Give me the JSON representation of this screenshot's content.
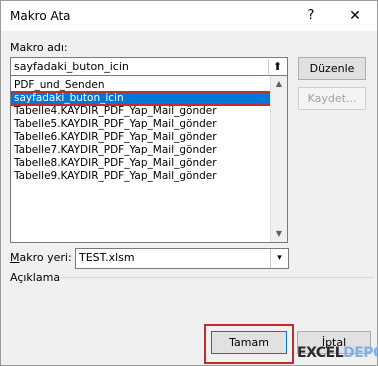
{
  "window": {
    "title": "Makro Ata",
    "help": "?",
    "close": "✕"
  },
  "macro_name": {
    "label": "Makro adı:",
    "value": "sayfadaki_buton_icin",
    "ref_icon": "⬆"
  },
  "macro_list": {
    "items": [
      "PDF_und_Senden",
      "sayfadaki_buton_icin",
      "Tabelle4.KAYDIR_PDF_Yap_Mail_gönder",
      "Tabelle5.KAYDIR_PDF_Yap_Mail_gönder",
      "Tabelle6.KAYDIR_PDF_Yap_Mail_gönder",
      "Tabelle7.KAYDIR_PDF_Yap_Mail_gönder",
      "Tabelle8.KAYDIR_PDF_Yap_Mail_gönder",
      "Tabelle9.KAYDIR_PDF_Yap_Mail_gönder"
    ],
    "selected_index": 1,
    "scroll_up": "▲",
    "scroll_down": "▼"
  },
  "buttons": {
    "edit": "Düzenle",
    "record": "Kaydet...",
    "ok": "Tamam",
    "cancel": "İptal"
  },
  "macros_in": {
    "label": "Makro yeri:",
    "value": "TEST.xlsm",
    "arrow": "▾"
  },
  "description": {
    "label": "Açıklama"
  },
  "watermark": {
    "part1": "EXCEL",
    "part2": "DEPO"
  }
}
